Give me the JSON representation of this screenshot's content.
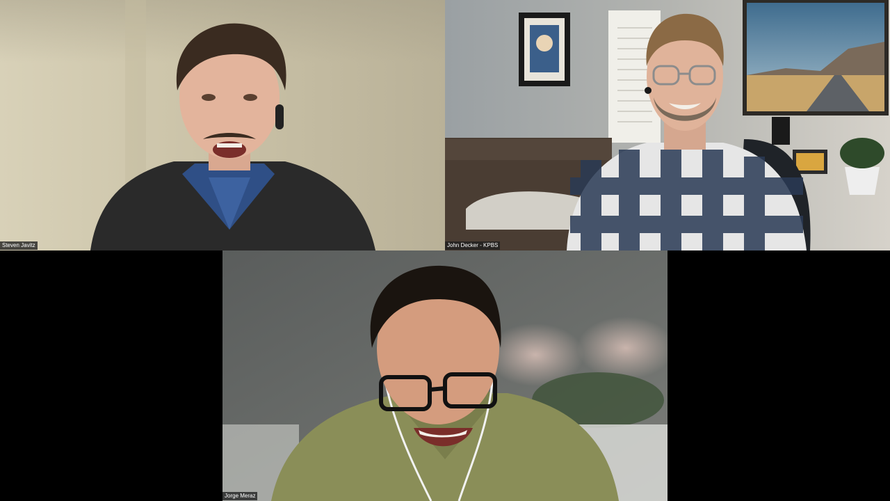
{
  "participants": [
    {
      "name": "Steven Javitz"
    },
    {
      "name": "John Decker - KPBS"
    },
    {
      "name": "Jorge Meraz"
    }
  ],
  "colors": {
    "background": "#000000",
    "name_tag_bg": "#1e1e1e",
    "name_tag_text": "#ffffff"
  }
}
